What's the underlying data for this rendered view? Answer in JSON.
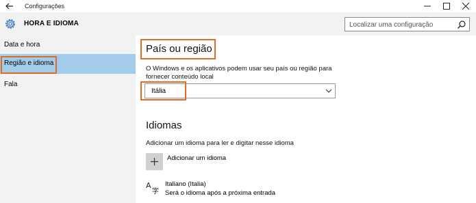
{
  "window": {
    "title": "Configurações"
  },
  "header": {
    "title": "HORA E IDIOMA"
  },
  "search": {
    "placeholder": "Localizar uma configuração"
  },
  "sidebar": {
    "items": [
      {
        "label": "Data e hora",
        "selected": false
      },
      {
        "label": "Região e idioma",
        "selected": true
      },
      {
        "label": "Fala",
        "selected": false
      }
    ]
  },
  "region": {
    "heading": "País ou região",
    "description": "O Windows e os aplicativos podem usar seu país ou região para fornecer conteúdo local",
    "selected_country": "Itália"
  },
  "languages": {
    "heading": "Idiomas",
    "description": "Adicionar um idioma para ler e digitar nesse idioma",
    "add_label": "Adicionar um idioma",
    "items": [
      {
        "name": "Italiano (Italia)",
        "note": "Será o idioma após a próxima entrada"
      }
    ]
  },
  "colors": {
    "accent": "#a3cbea",
    "highlight": "#e46a1e",
    "pane": "#f2f2f2"
  },
  "icons": [
    "back-arrow-icon",
    "minimize-icon",
    "maximize-icon",
    "close-icon",
    "gear-icon",
    "search-icon",
    "chevron-down-icon",
    "plus-icon",
    "language-icon"
  ]
}
